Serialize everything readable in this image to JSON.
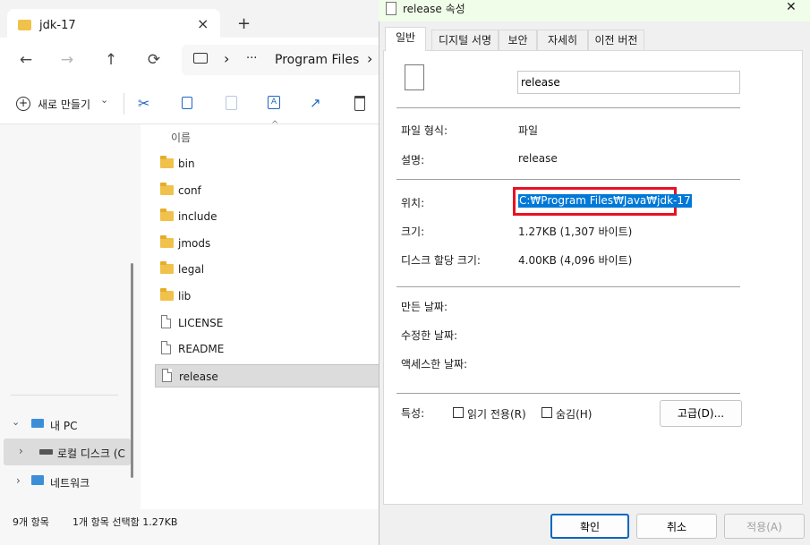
{
  "explorer": {
    "tab_title": "jdk-17",
    "new_tab": "+",
    "close_tab": "×",
    "breadcrumb": {
      "ellipsis": "···",
      "sep1": "›",
      "sep2": "›",
      "segment": "Program Files"
    },
    "nav": {
      "back": "←",
      "forward": "→",
      "up": "↑",
      "refresh": "⟳"
    },
    "toolbar": {
      "new_label": "새로 만들기",
      "new_chevron": "⌄"
    },
    "column_header": "이름",
    "files": [
      {
        "name": "bin",
        "type": "folder"
      },
      {
        "name": "conf",
        "type": "folder"
      },
      {
        "name": "include",
        "type": "folder"
      },
      {
        "name": "jmods",
        "type": "folder"
      },
      {
        "name": "legal",
        "type": "folder"
      },
      {
        "name": "lib",
        "type": "folder"
      },
      {
        "name": "LICENSE",
        "type": "file"
      },
      {
        "name": "README",
        "type": "file"
      },
      {
        "name": "release",
        "type": "file",
        "selected": true
      }
    ],
    "sidebar": {
      "this_pc": "내 PC",
      "local_disk": "로컬 디스크 (C",
      "network": "네트워크"
    },
    "status": {
      "item_count": "9개 항목",
      "selection": "1개 항목 선택함 1.27KB"
    }
  },
  "dialog": {
    "title": "release 속성",
    "close": "✕",
    "tabs": [
      "일반",
      "디지털 서명",
      "보안",
      "자세히",
      "이전 버전"
    ],
    "filename": "release",
    "fields": {
      "type_label": "파일 형식:",
      "type_value": "파일",
      "desc_label": "설명:",
      "desc_value": "release",
      "location_label": "위치:",
      "location_value": "C:₩Program Files₩Java₩jdk-17",
      "size_label": "크기:",
      "size_value": "1.27KB (1,307 바이트)",
      "disk_size_label": "디스크 할당 크기:",
      "disk_size_value": "4.00KB (4,096 바이트)",
      "created_label": "만든 날짜:",
      "modified_label": "수정한 날짜:",
      "accessed_label": "액세스한 날짜:",
      "attributes_label": "특성:",
      "readonly_label": "읽기 전용(R)",
      "hidden_label": "숨김(H)",
      "advanced_label": "고급(D)..."
    },
    "buttons": {
      "ok": "확인",
      "cancel": "취소",
      "apply": "적용(A)"
    },
    "highlight_color": "#e81123",
    "selection_color": "#0078d7"
  }
}
